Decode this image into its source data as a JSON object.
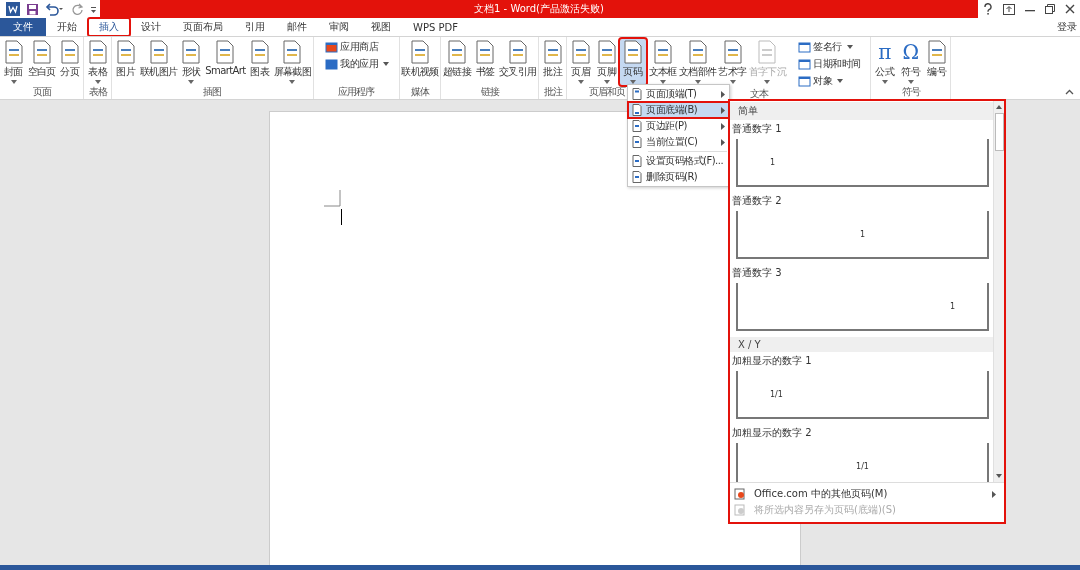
{
  "window": {
    "title": "文档1 - Word(产品激活失败)",
    "signin": "登录"
  },
  "tabs": [
    {
      "label": "文件",
      "kind": "file",
      "selected": false
    },
    {
      "label": "开始",
      "kind": "tab",
      "selected": false
    },
    {
      "label": "插入",
      "kind": "tab",
      "selected": true
    },
    {
      "label": "设计",
      "kind": "tab",
      "selected": false
    },
    {
      "label": "页面布局",
      "kind": "tab",
      "selected": false
    },
    {
      "label": "引用",
      "kind": "tab",
      "selected": false
    },
    {
      "label": "邮件",
      "kind": "tab",
      "selected": false
    },
    {
      "label": "审阅",
      "kind": "tab",
      "selected": false
    },
    {
      "label": "视图",
      "kind": "tab",
      "selected": false
    },
    {
      "label": "WPS PDF",
      "kind": "tab",
      "selected": false
    }
  ],
  "ribbon": [
    {
      "label": "页面",
      "items": [
        {
          "kind": "large",
          "label": "封面",
          "dropdown": true,
          "disabled": false,
          "selected": false
        },
        {
          "kind": "large",
          "label": "空白页",
          "dropdown": false,
          "disabled": false,
          "selected": false
        },
        {
          "kind": "large",
          "label": "分页",
          "dropdown": false,
          "disabled": false,
          "selected": false
        }
      ]
    },
    {
      "label": "表格",
      "items": [
        {
          "kind": "large",
          "label": "表格",
          "dropdown": true,
          "disabled": false,
          "selected": false
        }
      ]
    },
    {
      "label": "插图",
      "items": [
        {
          "kind": "large",
          "label": "图片",
          "dropdown": false,
          "disabled": false,
          "selected": false
        },
        {
          "kind": "large",
          "label": "联机图片",
          "dropdown": false,
          "disabled": false,
          "selected": false
        },
        {
          "kind": "large",
          "label": "形状",
          "dropdown": true,
          "disabled": false,
          "selected": false
        },
        {
          "kind": "large",
          "label": "SmartArt",
          "dropdown": false,
          "disabled": false,
          "selected": false
        },
        {
          "kind": "large",
          "label": "图表",
          "dropdown": false,
          "disabled": false,
          "selected": false
        },
        {
          "kind": "large",
          "label": "屏幕截图",
          "dropdown": true,
          "disabled": false,
          "selected": false
        }
      ]
    },
    {
      "label": "应用程序",
      "items": [
        {
          "kind": "small",
          "label": "应用商店",
          "dropdown": false,
          "disabled": false,
          "selected": false
        },
        {
          "kind": "small",
          "label": "我的应用",
          "dropdown": true,
          "disabled": false,
          "selected": false
        }
      ]
    },
    {
      "label": "媒体",
      "items": [
        {
          "kind": "large",
          "label": "联机视频",
          "dropdown": false,
          "disabled": false,
          "selected": false
        }
      ]
    },
    {
      "label": "链接",
      "items": [
        {
          "kind": "large",
          "label": "超链接",
          "dropdown": false,
          "disabled": false,
          "selected": false
        },
        {
          "kind": "large",
          "label": "书签",
          "dropdown": false,
          "disabled": false,
          "selected": false
        },
        {
          "kind": "large",
          "label": "交叉引用",
          "dropdown": false,
          "disabled": false,
          "selected": false
        }
      ]
    },
    {
      "label": "批注",
      "items": [
        {
          "kind": "large",
          "label": "批注",
          "dropdown": false,
          "disabled": false,
          "selected": false
        }
      ]
    },
    {
      "label": "页眉和页",
      "items": [
        {
          "kind": "large",
          "label": "页眉",
          "dropdown": true,
          "disabled": false,
          "selected": false
        },
        {
          "kind": "large",
          "label": "页脚",
          "dropdown": true,
          "disabled": false,
          "selected": false
        },
        {
          "kind": "large",
          "label": "页码",
          "dropdown": true,
          "disabled": false,
          "selected": true
        }
      ]
    },
    {
      "label": "文本",
      "items": [
        {
          "kind": "large",
          "label": "文本框",
          "dropdown": true,
          "disabled": false,
          "selected": false
        },
        {
          "kind": "large",
          "label": "文档部件",
          "dropdown": true,
          "disabled": false,
          "selected": false
        },
        {
          "kind": "large",
          "label": "艺术字",
          "dropdown": true,
          "disabled": false,
          "selected": false
        },
        {
          "kind": "large",
          "label": "首字下沉",
          "dropdown": true,
          "disabled": true,
          "selected": false
        },
        {
          "kind": "small",
          "label": "签名行",
          "dropdown": true,
          "disabled": false,
          "selected": false
        },
        {
          "kind": "small",
          "label": "日期和时间",
          "dropdown": false,
          "disabled": false,
          "selected": false
        },
        {
          "kind": "small",
          "label": "对象",
          "dropdown": true,
          "disabled": false,
          "selected": false
        }
      ]
    },
    {
      "label": "符号",
      "items": [
        {
          "kind": "glyph",
          "glyph": "π",
          "label": "公式",
          "dropdown": true,
          "disabled": false,
          "selected": false
        },
        {
          "kind": "glyph",
          "glyph": "Ω",
          "label": "符号",
          "dropdown": true,
          "disabled": false,
          "selected": false
        },
        {
          "kind": "large",
          "label": "编号",
          "dropdown": false,
          "disabled": false,
          "selected": false
        }
      ]
    }
  ],
  "menu": [
    {
      "label": "页面顶端(T)",
      "submenu": true,
      "selected": false
    },
    {
      "label": "页面底端(B)",
      "submenu": true,
      "selected": true
    },
    {
      "label": "页边距(P)",
      "submenu": true,
      "selected": false
    },
    {
      "label": "当前位置(C)",
      "submenu": true,
      "selected": false
    },
    {
      "label": "设置页码格式(F)...",
      "submenu": false,
      "selected": false
    },
    {
      "label": "删除页码(R)",
      "submenu": false,
      "selected": false
    }
  ],
  "gallery": {
    "highlighted": true,
    "sections": [
      {
        "heading": "简单",
        "items": [
          {
            "label": "普通数字 1",
            "preview": "1",
            "kind": "left"
          },
          {
            "label": "普通数字 2",
            "preview": "1",
            "kind": "center"
          },
          {
            "label": "普通数字 3",
            "preview": "1",
            "kind": "right"
          }
        ]
      },
      {
        "heading": "X / Y",
        "items": [
          {
            "label": "加粗显示的数字 1",
            "preview": "1/1",
            "kind": "left"
          },
          {
            "label": "加粗显示的数字 2",
            "preview": "1/1",
            "kind": "center"
          }
        ]
      }
    ],
    "footer": [
      {
        "label": "Office.com 中的其他页码(M)",
        "submenu": true,
        "disabled": false
      },
      {
        "label": "将所选内容另存为页码(底端)(S)",
        "submenu": false,
        "disabled": true
      }
    ]
  }
}
